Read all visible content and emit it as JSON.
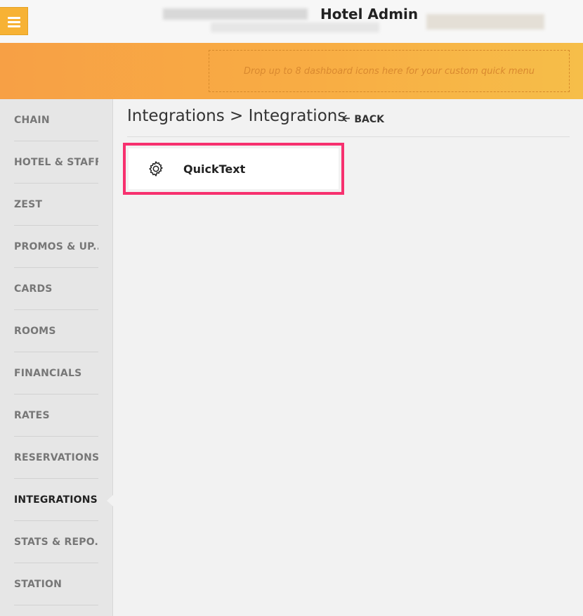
{
  "header": {
    "title": "Hotel Admin"
  },
  "quick_menu": {
    "placeholder": "Drop up to 8 dashboard icons here for your custom quick menu"
  },
  "sidebar": {
    "items": [
      {
        "label": "CHAIN"
      },
      {
        "label": "HOTEL & STAFF"
      },
      {
        "label": "ZEST"
      },
      {
        "label": "PROMOS & UP..."
      },
      {
        "label": "CARDS"
      },
      {
        "label": "ROOMS"
      },
      {
        "label": "FINANCIALS"
      },
      {
        "label": "RATES"
      },
      {
        "label": "RESERVATIONS"
      },
      {
        "label": "INTEGRATIONS"
      },
      {
        "label": "STATS & REPO..."
      },
      {
        "label": "STATION"
      }
    ],
    "active": "INTEGRATIONS"
  },
  "main": {
    "breadcrumb": "Integrations > Integrations",
    "back_label": "BACK",
    "back_icon": "arrow-left-icon",
    "cards": [
      {
        "label": "QuickText",
        "icon": "gear-icon"
      }
    ]
  },
  "colors": {
    "accent": "#f7b234",
    "highlight": "#f7316f"
  }
}
